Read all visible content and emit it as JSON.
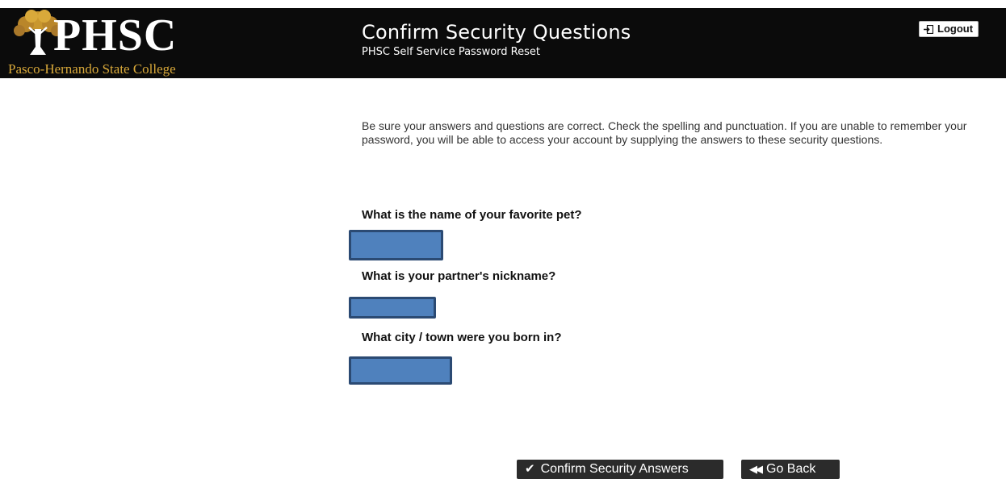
{
  "header": {
    "logo": {
      "letters": "PHSC",
      "subtitle": "Pasco-Hernando State College"
    },
    "title": "Confirm Security Questions",
    "subtitle": "PHSC Self Service Password Reset",
    "logout_label": "Logout"
  },
  "main": {
    "intro": "Be sure your answers and questions are correct. Check the spelling and punctuation. If you are unable to remember your password, you will be able to access your account by supplying the answers to these security questions.",
    "questions": [
      {
        "label": "What is the name of your favorite pet?",
        "answer": ""
      },
      {
        "label": "What is your partner's nickname?",
        "answer": ""
      },
      {
        "label": "What city / town were you born in?",
        "answer": ""
      }
    ]
  },
  "actions": {
    "confirm_label": "Confirm Security Answers",
    "back_label": "Go Back"
  },
  "colors": {
    "header_bg": "#0b0b0b",
    "logo_gold": "#d9a93a",
    "answer_fill": "#4f81bd",
    "button_bg": "#2b2b2b"
  }
}
